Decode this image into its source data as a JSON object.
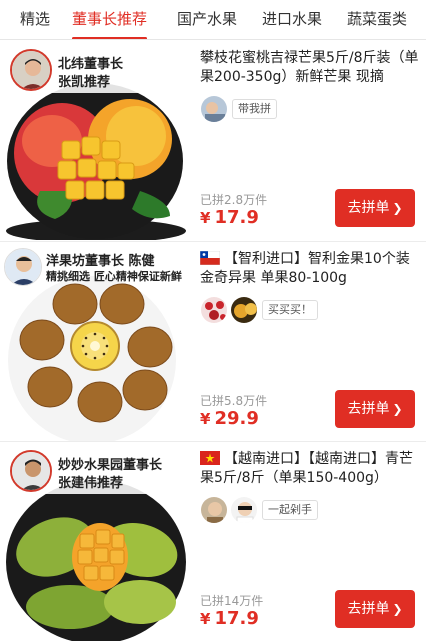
{
  "tabs": [
    {
      "label": "精选",
      "active": false
    },
    {
      "label": "董事长推荐",
      "active": true
    },
    {
      "label": "国产水果",
      "active": false
    },
    {
      "label": "进口水果",
      "active": false
    },
    {
      "label": "蔬菜蛋类",
      "active": false
    }
  ],
  "colors": {
    "accent": "#e02e24",
    "text": "#222222",
    "muted": "#999999"
  },
  "products": [
    {
      "badge_line1": "北纬董事长",
      "badge_line2": "张凯推荐",
      "title": "攀枝花蜜桃吉禄芒果5斤/8斤装（单果200-350g）新鲜芒果 现摘",
      "flag": "",
      "buyer_tag": "带我拼",
      "sold": "已拼2.8万件",
      "currency": "¥",
      "price": "17.9",
      "button_label": "去拼单",
      "button_icon": "chevron-right-icon"
    },
    {
      "badge_line1": "洋果坊董事长 陈健",
      "badge_line2": "精挑细选 匠心精神保证新鲜",
      "title": "【智利进口】智利金果10个装 金奇异果 单果80-100g",
      "flag": "chile-flag",
      "buyer_tag": "买买买！",
      "sold": "已拼5.8万件",
      "currency": "¥",
      "price": "29.9",
      "button_label": "去拼单",
      "button_icon": "chevron-right-icon"
    },
    {
      "badge_line1": "妙妙水果园董事长",
      "badge_line2": "张建伟推荐",
      "title": "【越南进口】【越南进口】青芒果5斤/8斤（单果150-400g）",
      "flag": "vietnam-flag",
      "buyer_tag": "一起剁手",
      "sold": "已拼14万件",
      "currency": "¥",
      "price": "17.9",
      "button_label": "去拼单",
      "button_icon": "chevron-right-icon"
    }
  ]
}
